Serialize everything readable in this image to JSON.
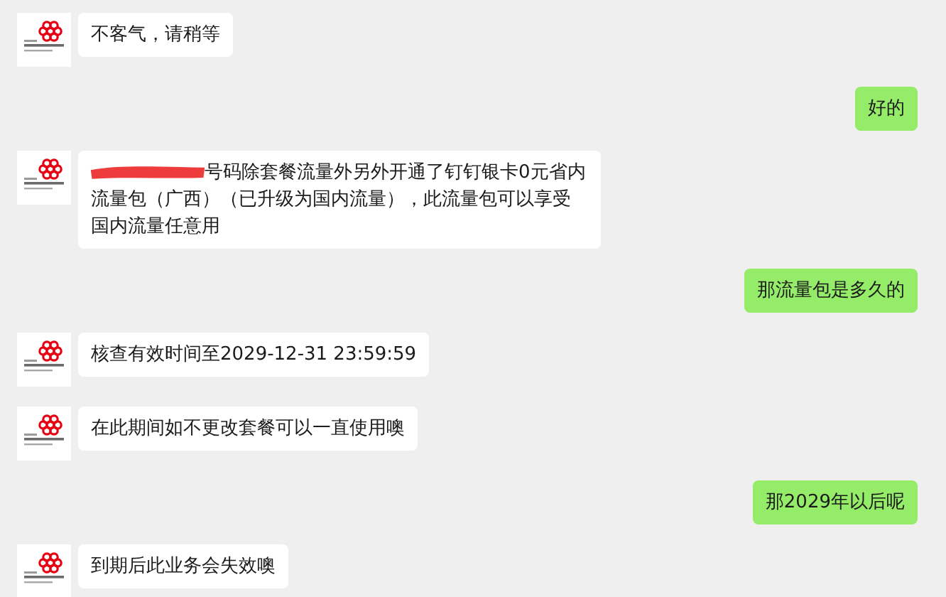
{
  "messages": [
    {
      "kind": "incoming",
      "text": "不客气，请稍等"
    },
    {
      "kind": "outgoing",
      "text": "好的"
    },
    {
      "kind": "incoming",
      "redacted": true,
      "text": "号码除套餐流量外另外开通了钉钉银卡0元省内流量包（广西）（已升级为国内流量），此流量包可以享受国内流量任意用"
    },
    {
      "kind": "outgoing",
      "text": "那流量包是多久的"
    },
    {
      "kind": "incoming",
      "text": "核查有效时间至2029-12-31 23:59:59"
    },
    {
      "kind": "incoming",
      "text": "在此期间如不更改套餐可以一直使用噢"
    },
    {
      "kind": "outgoing",
      "text": "那2029年以后呢"
    },
    {
      "kind": "incoming",
      "text": "到期后此业务会失效噢"
    }
  ]
}
